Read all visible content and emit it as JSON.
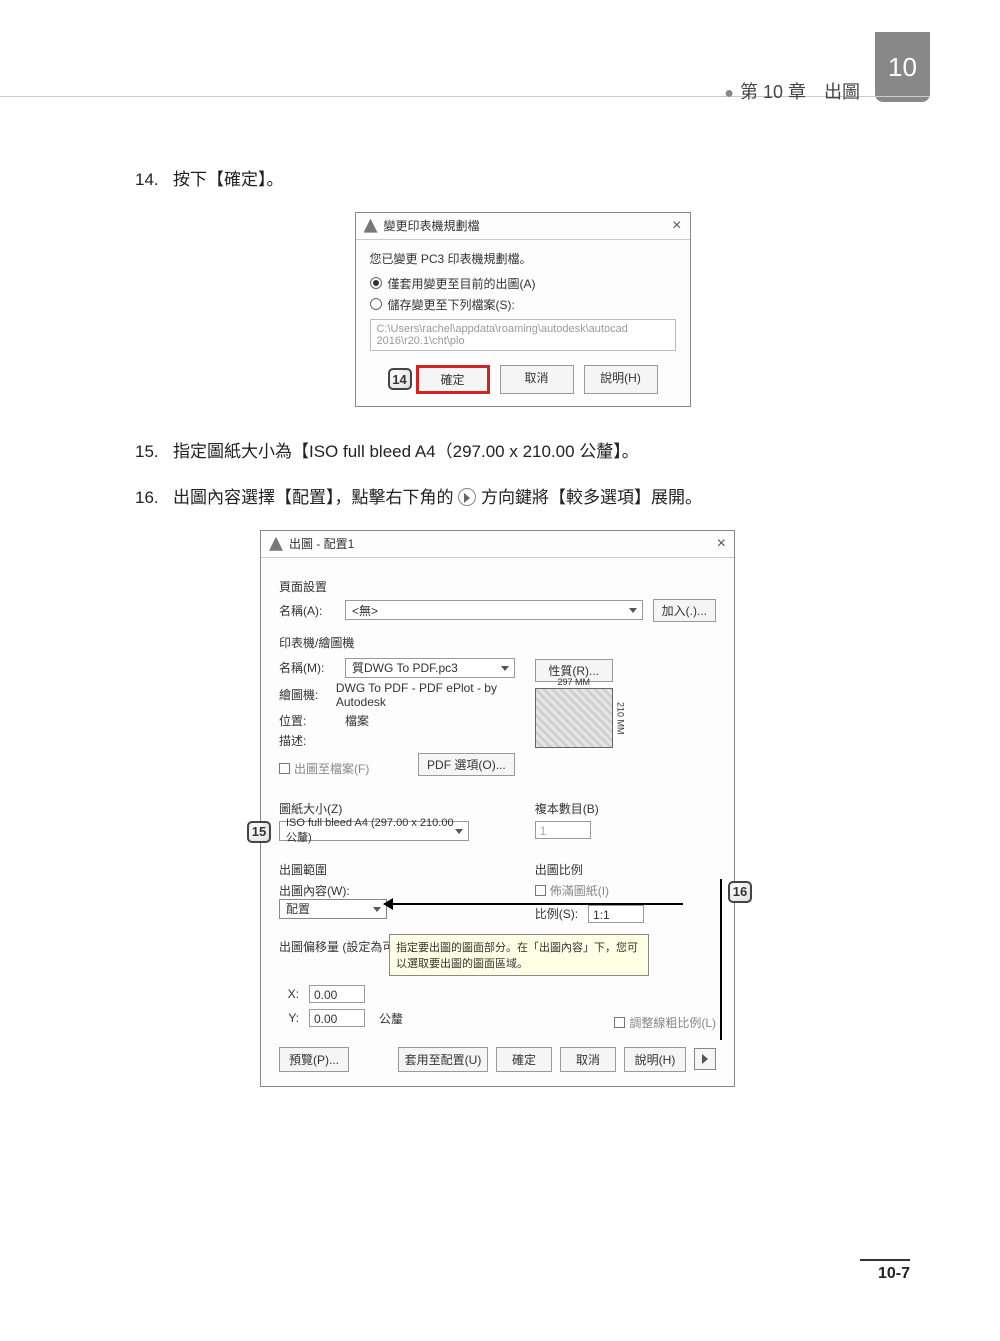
{
  "page": {
    "chapter_tab": "10",
    "chapter_title": "第 10 章　出圖",
    "page_number": "10-7"
  },
  "steps": {
    "s14": {
      "num": "14.",
      "text": "按下【確定】。"
    },
    "s15": {
      "num": "15.",
      "text": "指定圖紙大小為【ISO full bleed A4（297.00 x 210.00 公釐】。"
    },
    "s16": {
      "num": "16.",
      "text_a": "出圖內容選擇【配置】，點擊右下角的",
      "text_b": "方向鍵將【較多選項】展開。"
    }
  },
  "callouts": {
    "c14": "14",
    "c15": "15",
    "c16": "16"
  },
  "dlg1": {
    "title": "變更印表機規劃檔",
    "msg": "您已變更 PC3 印表機規劃檔。",
    "opt_a": "僅套用變更至目前的出圖(A)",
    "opt_s": "儲存變更至下列檔案(S):",
    "path": "C:\\Users\\rachel\\appdata\\roaming\\autodesk\\autocad 2016\\r20.1\\cht\\plo",
    "ok": "確定",
    "cancel": "取消",
    "help": "說明(H)"
  },
  "dlg2": {
    "title": "出圖 - 配置1",
    "page_setup": "頁面設置",
    "name_lbl": "名稱(A):",
    "name_val": "<無>",
    "add_btn": "加入(.)...",
    "printer_section": "印表機/繪圖機",
    "pname_lbl": "名稱(M):",
    "pname_val": "質DWG To PDF.pc3",
    "props_btn": "性質(R)...",
    "plotter_lbl": "繪圖機:",
    "plotter_val": "DWG To PDF - PDF ePlot - by Autodesk",
    "where_lbl": "位置:",
    "where_val": "檔案",
    "desc_lbl": "描述:",
    "plot_to_file": "出圖至檔案(F)",
    "pdf_options": "PDF 選項(O)...",
    "paper_lbl": "圖紙大小(Z)",
    "paper_val": "ISO full bleed A4 (297.00 x 210.00 公釐)",
    "copies_lbl": "複本數目(B)",
    "copies_val": "1",
    "area_lbl": "出圖範圍",
    "what_lbl": "出圖內容(W):",
    "what_val": "配置",
    "scale_lbl": "出圖比例",
    "fit_lbl": "佈滿圖紙(I)",
    "scale_s_lbl": "比例(S):",
    "scale_s_val": "1:1",
    "offset_lbl": "出圖偏移量 (設定為可",
    "tooltip": "指定要出圖的圖面部分。在「出圖內容」下，您可以選取要出圖的圖面區域。",
    "x_lbl": "X:",
    "x_val": "0.00",
    "y_lbl": "Y:",
    "y_val": "0.00",
    "mm": "公釐",
    "scale_lw": "調整線粗比例(L)",
    "preview_btn": "預覽(P)...",
    "apply_btn": "套用至配置(U)",
    "ok": "確定",
    "cancel": "取消",
    "help": "說明(H)",
    "dim_w": "297 MM",
    "dim_h": "210 MM"
  }
}
